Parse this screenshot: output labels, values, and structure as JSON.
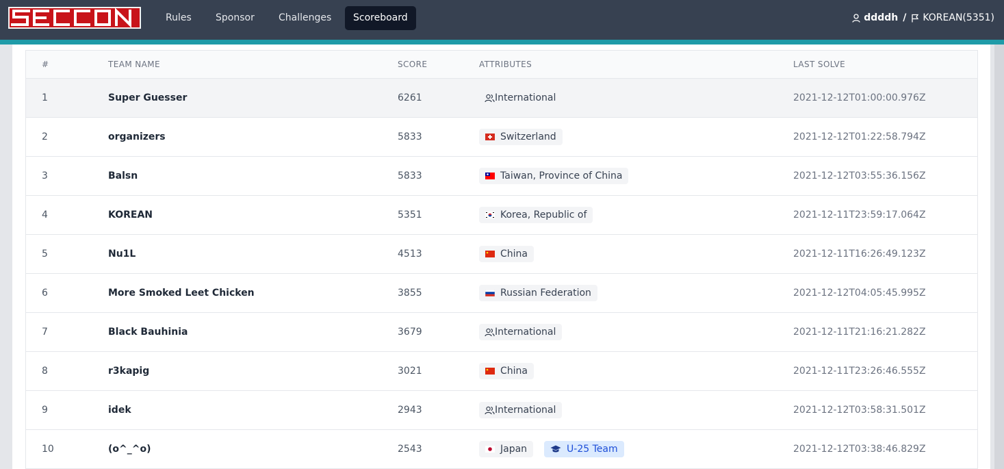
{
  "nav": {
    "logo": "SECCON",
    "items": [
      {
        "label": "Rules",
        "active": false
      },
      {
        "label": "Sponsor",
        "active": false
      },
      {
        "label": "Challenges",
        "active": false
      },
      {
        "label": "Scoreboard",
        "active": true
      }
    ],
    "user": {
      "name": "ddddh",
      "separator": "/",
      "team": "KOREAN(5351)",
      "user_icon": "user-icon",
      "team_icon": "flag-icon"
    }
  },
  "colors": {
    "navbar": "#374151",
    "accent": "#1f9ba8",
    "logo": "#c8141a"
  },
  "table": {
    "headers": {
      "rank": "#",
      "team": "TEAM NAME",
      "score": "SCORE",
      "attributes": "ATTRIBUTES",
      "last_solve": "LAST SOLVE"
    },
    "rows": [
      {
        "rank": "1",
        "team": "Super Guesser",
        "score": "6261",
        "attributes": [
          {
            "label": "International",
            "type": "intl",
            "plain": true
          }
        ],
        "last_solve": "2021-12-12T01:00:00.976Z"
      },
      {
        "rank": "2",
        "team": "organizers",
        "score": "5833",
        "attributes": [
          {
            "label": "Switzerland",
            "type": "flag",
            "flag": "ch"
          }
        ],
        "last_solve": "2021-12-12T01:22:58.794Z"
      },
      {
        "rank": "3",
        "team": "Balsn",
        "score": "5833",
        "attributes": [
          {
            "label": "Taiwan, Province of China",
            "type": "flag",
            "flag": "tw"
          }
        ],
        "last_solve": "2021-12-12T03:55:36.156Z"
      },
      {
        "rank": "4",
        "team": "KOREAN",
        "score": "5351",
        "attributes": [
          {
            "label": "Korea, Republic of",
            "type": "flag",
            "flag": "kr"
          }
        ],
        "last_solve": "2021-12-11T23:59:17.064Z"
      },
      {
        "rank": "5",
        "team": "Nu1L",
        "score": "4513",
        "attributes": [
          {
            "label": "China",
            "type": "flag",
            "flag": "cn"
          }
        ],
        "last_solve": "2021-12-11T16:26:49.123Z"
      },
      {
        "rank": "6",
        "team": "More Smoked Leet Chicken",
        "score": "3855",
        "attributes": [
          {
            "label": "Russian Federation",
            "type": "flag",
            "flag": "ru"
          }
        ],
        "last_solve": "2021-12-12T04:05:45.995Z"
      },
      {
        "rank": "7",
        "team": "Black Bauhinia",
        "score": "3679",
        "attributes": [
          {
            "label": "International",
            "type": "intl"
          }
        ],
        "last_solve": "2021-12-11T21:16:21.282Z"
      },
      {
        "rank": "8",
        "team": "r3kapig",
        "score": "3021",
        "attributes": [
          {
            "label": "China",
            "type": "flag",
            "flag": "cn"
          }
        ],
        "last_solve": "2021-12-11T23:26:46.555Z"
      },
      {
        "rank": "9",
        "team": "idek",
        "score": "2943",
        "attributes": [
          {
            "label": "International",
            "type": "intl"
          }
        ],
        "last_solve": "2021-12-12T03:58:31.501Z"
      },
      {
        "rank": "10",
        "team": "(o^_^o)",
        "score": "2543",
        "attributes": [
          {
            "label": "Japan",
            "type": "flag",
            "flag": "jp"
          },
          {
            "label": "U-25 Team",
            "type": "u25"
          }
        ],
        "last_solve": "2021-12-12T03:38:46.829Z"
      }
    ]
  }
}
